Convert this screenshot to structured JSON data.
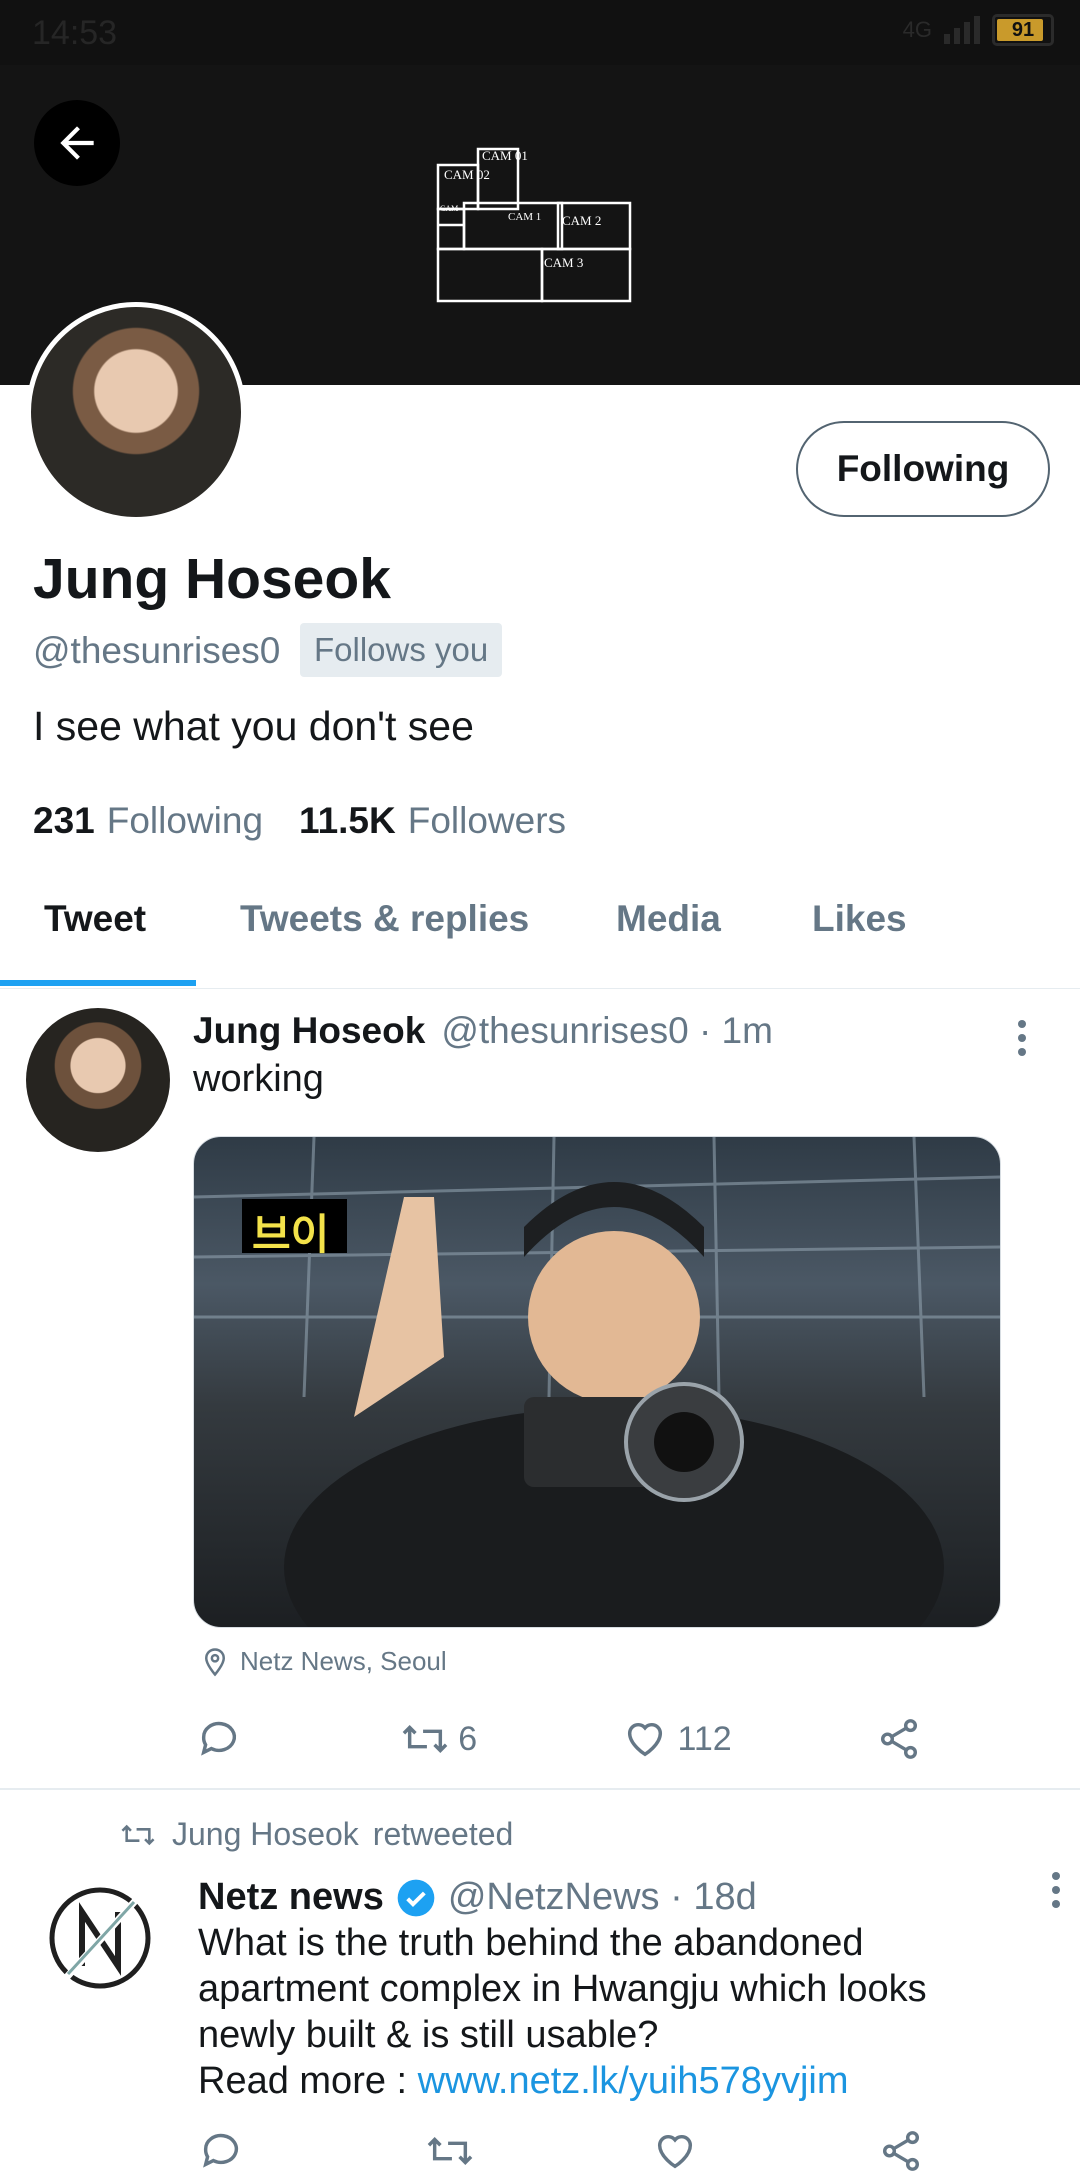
{
  "status_bar": {
    "time": "14:53",
    "network": "4G",
    "battery": "91"
  },
  "banner": {
    "cams": [
      "CAM 01",
      "CAM 02",
      "CAM",
      "CAM 1",
      "CAM 2",
      "CAM 3"
    ]
  },
  "profile": {
    "name": "Jung Hoseok",
    "handle": "@thesunrises0",
    "follows_you": "Follows you",
    "bio": "I see what you don't see",
    "following_count": "231",
    "following_label": "Following",
    "followers_count": "11.5K",
    "followers_label": "Followers",
    "follow_button": "Following"
  },
  "tabs": [
    {
      "label": "Tweet",
      "active": true
    },
    {
      "label": "Tweets & replies"
    },
    {
      "label": "Media"
    },
    {
      "label": "Likes"
    }
  ],
  "tweets": [
    {
      "name": "Jung Hoseok",
      "meta": "@thesunrises0 · 1m",
      "text": "working",
      "media_caption": "브이",
      "location": "Netz News, Seoul",
      "retweets": "6",
      "likes": "112"
    },
    {
      "retweeted_by": "Jung Hoseok",
      "retweeted_label": "retweeted",
      "name": "Netz news",
      "meta": "@NetzNews · 18d",
      "text": "What is the truth behind the abandoned apartment complex in Hwangju which looks newly built & is still usable?",
      "read_more": "Read more :",
      "link": "www.netz.lk/yuih578yvjim"
    }
  ],
  "colors": {
    "accent": "#1da1f2",
    "link": "#1b95e0",
    "muted": "#657786",
    "verified": "#1da1f2"
  }
}
